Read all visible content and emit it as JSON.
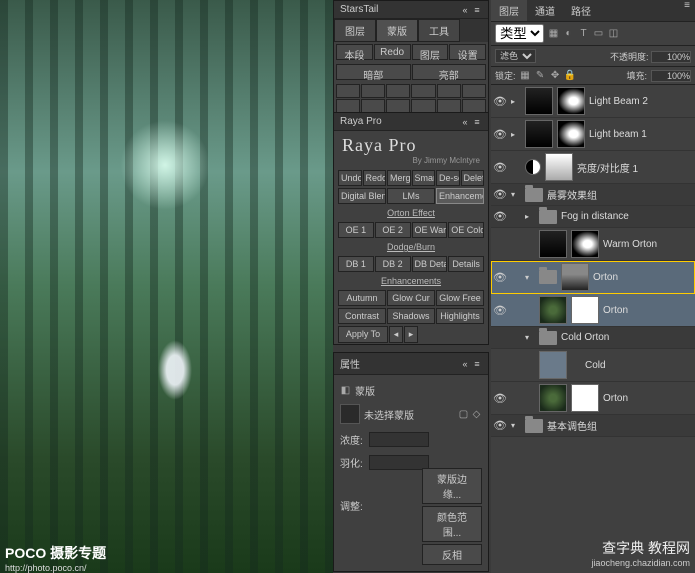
{
  "watermark1": {
    "title": "POCO 摄影专题",
    "url": "http://photo.poco.cn/"
  },
  "watermark2": {
    "title": "查字典 教程网",
    "url": "jiaocheng.chazidian.com"
  },
  "starsTail": {
    "title": "StarsTail",
    "tabs": [
      "图层",
      "蒙版",
      "工具"
    ],
    "row1": [
      "本段",
      "Redo",
      "图层",
      "设置"
    ],
    "row2": [
      "暗部",
      "亮部"
    ]
  },
  "raya": {
    "panel": "Raya Pro",
    "title": "Raya Pro",
    "sub": "By Jimmy McIntyre",
    "row1": [
      "Undo",
      "Redo",
      "Merge",
      "Smart",
      "De-sel",
      "Delete"
    ],
    "tabs": [
      "Digital Blending",
      "LMs",
      "Enhancements"
    ],
    "section1": "Orton Effect",
    "s1row": [
      "OE 1",
      "OE 2",
      "OE Warm",
      "OE Cold"
    ],
    "section2": "Dodge/Burn",
    "s2row": [
      "DB 1",
      "DB 2",
      "DB Details",
      "Details"
    ],
    "section3": "Enhancements",
    "s3r1": [
      "Autumn",
      "Glow Cur",
      "Glow Free"
    ],
    "s3r2": [
      "Contrast",
      "Shadows",
      "Highlights"
    ],
    "apply": "Apply To"
  },
  "props": {
    "title": "属性",
    "type": "蒙版",
    "sel": "未选择蒙版",
    "density": "浓度:",
    "feather": "羽化:",
    "adjust": "调整:",
    "btns": [
      "蒙版边缘...",
      "颜色范围...",
      "反相"
    ]
  },
  "layers": {
    "tabs": [
      "图层",
      "通道",
      "路径"
    ],
    "kind": "类型",
    "blend": "滤色",
    "opacityLabel": "不透明度:",
    "opacity": "100%",
    "lock": "锁定:",
    "fillLabel": "填充:",
    "fill": "100%",
    "items": [
      {
        "name": "Light Beam 2"
      },
      {
        "name": "Light beam 1"
      },
      {
        "name": "亮度/对比度 1"
      },
      {
        "group": "晨雾效果组"
      },
      {
        "name": "Fog in distance"
      },
      {
        "name": "Warm Orton"
      },
      {
        "name": "Orton"
      },
      {
        "name": "Orton"
      },
      {
        "group": "Cold Orton"
      },
      {
        "name": "Cold"
      },
      {
        "name": "Orton"
      },
      {
        "group": "基本调色组"
      }
    ]
  }
}
